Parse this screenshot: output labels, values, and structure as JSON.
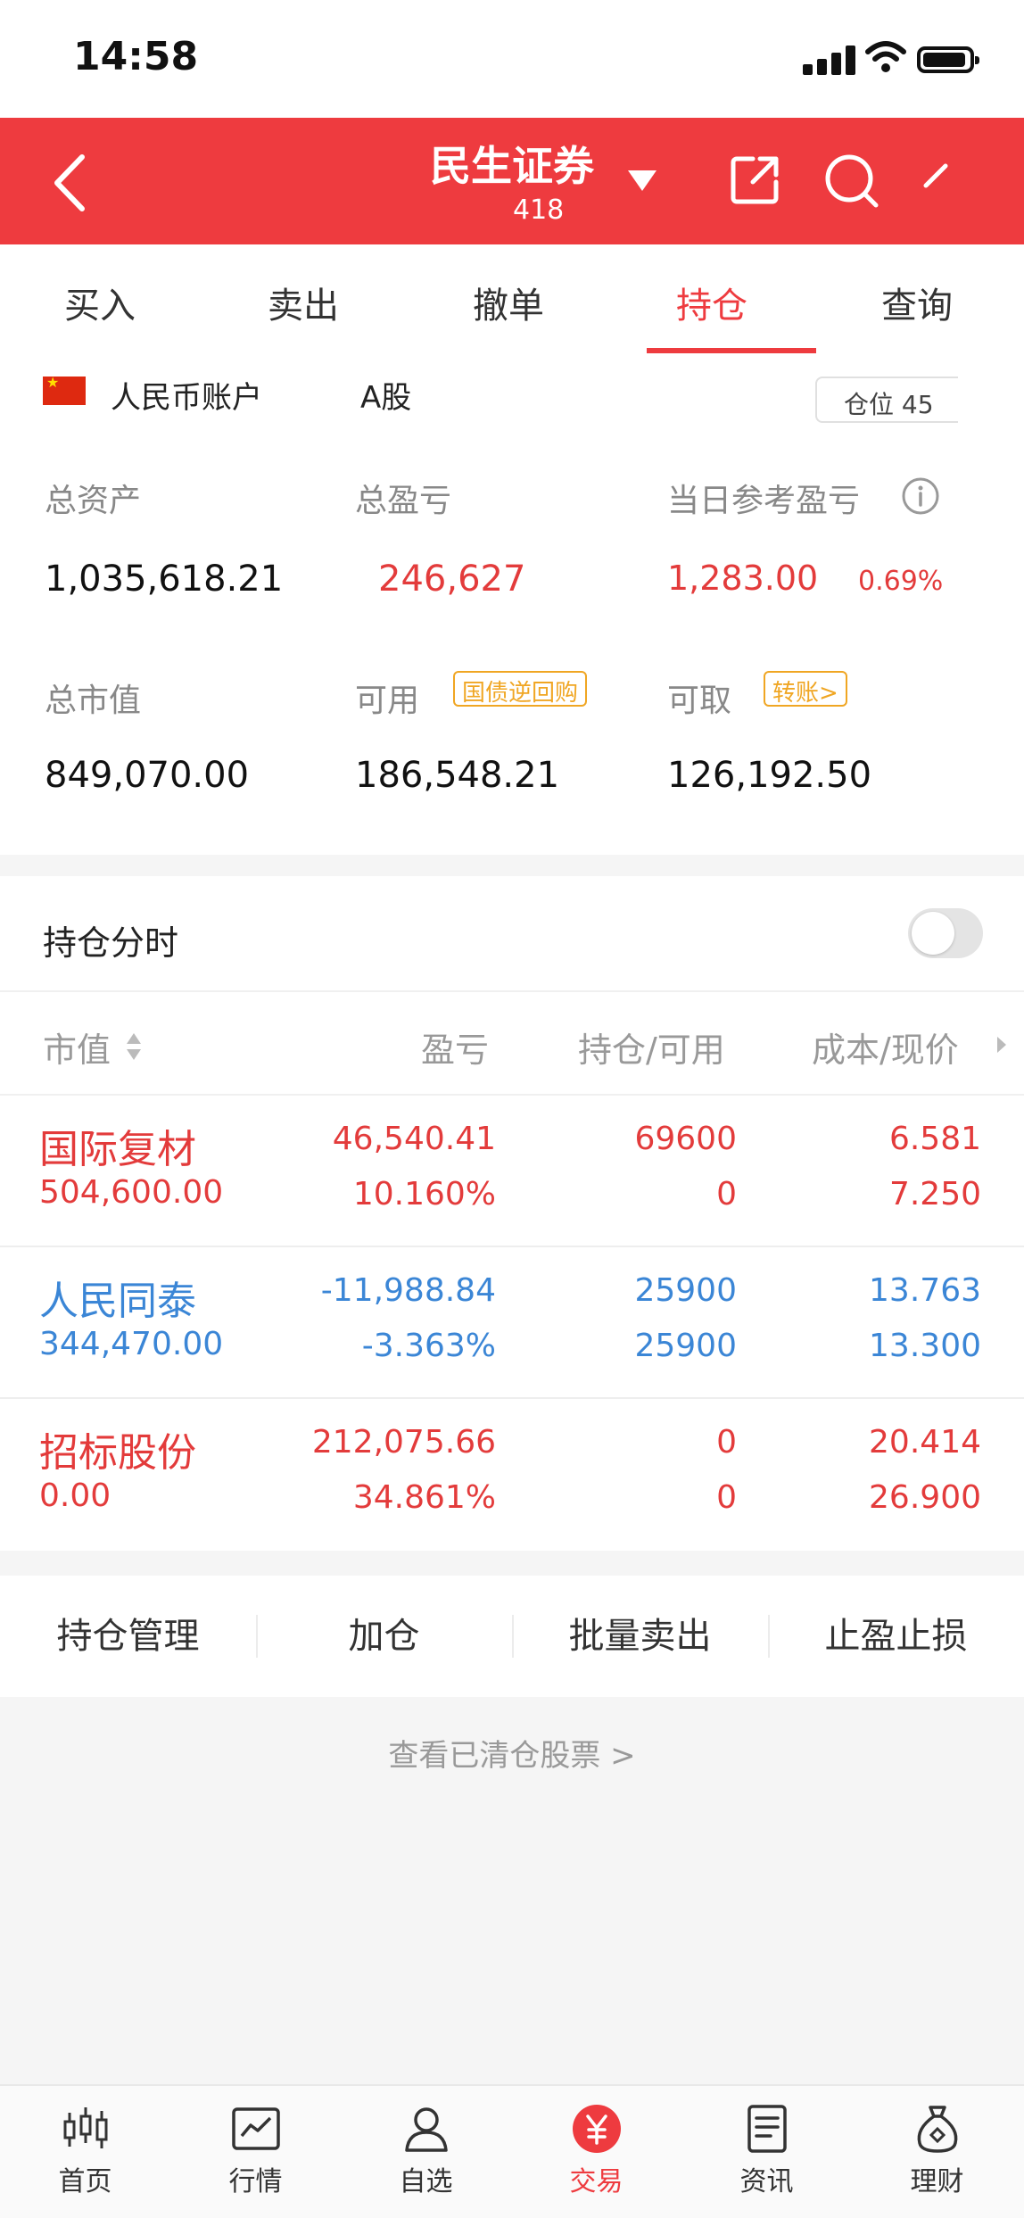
{
  "status_bar": {
    "time": "14:58"
  },
  "header": {
    "title": "民生证券",
    "subtitle": "418"
  },
  "tabs": [
    {
      "label": "买入",
      "active": false
    },
    {
      "label": "卖出",
      "active": false
    },
    {
      "label": "撤单",
      "active": false
    },
    {
      "label": "持仓",
      "active": true
    },
    {
      "label": "查询",
      "active": false
    }
  ],
  "account": {
    "label": "人民币账户",
    "type": "A股",
    "position": "仓位 45"
  },
  "metrics": {
    "total_assets": {
      "label": "总资产",
      "value": "1,035,618.21"
    },
    "total_pnl": {
      "label": "总盈亏",
      "value": "246,627"
    },
    "daily_pnl": {
      "label": "当日参考盈亏",
      "value": "1,283.00",
      "percent": "0.69%"
    },
    "market_value": {
      "label": "总市值",
      "value": "849,070.00"
    },
    "available": {
      "label": "可用",
      "value": "186,548.21",
      "tag": "国债逆回购"
    },
    "withdrawable": {
      "label": "可取",
      "value": "126,192.50",
      "tag": "转账>"
    }
  },
  "holdings": {
    "tab_label": "持仓分时",
    "columns": [
      "市值",
      "盈亏",
      "持仓/可用",
      "成本/现价"
    ],
    "rows": [
      {
        "name": "国际复材",
        "market_value": "504,600.00",
        "pnl": "46,540.41",
        "pnl_pct": "10.160%",
        "qty": "69600",
        "avail": "0",
        "cost": "6.581",
        "price": "7.250",
        "trend": "up"
      },
      {
        "name": "人民同泰",
        "market_value": "344,470.00",
        "pnl": "-11,988.84",
        "pnl_pct": "-3.363%",
        "qty": "25900",
        "avail": "25900",
        "cost": "13.763",
        "price": "13.300",
        "trend": "down"
      },
      {
        "name": "招标股份",
        "market_value": "0.00",
        "pnl": "212,075.66",
        "pnl_pct": "34.861%",
        "qty": "0",
        "avail": "0",
        "cost": "20.414",
        "price": "26.900",
        "trend": "up"
      }
    ]
  },
  "actions": [
    "持仓管理",
    "加仓",
    "批量卖出",
    "止盈止损"
  ],
  "cleared_link": "查看已清仓股票 >",
  "bottom_nav": [
    {
      "label": "首页",
      "icon": "candlestick-icon"
    },
    {
      "label": "行情",
      "icon": "chart-icon"
    },
    {
      "label": "自选",
      "icon": "person-icon"
    },
    {
      "label": "交易",
      "icon": "yuan-icon",
      "active": true
    },
    {
      "label": "资讯",
      "icon": "news-icon"
    },
    {
      "label": "理财",
      "icon": "money-bag-icon"
    }
  ],
  "colors": {
    "brand_red": "#ee3b3f",
    "up": "#e33b3b",
    "down": "#3b86d6",
    "tag_orange": "#f0a623"
  }
}
